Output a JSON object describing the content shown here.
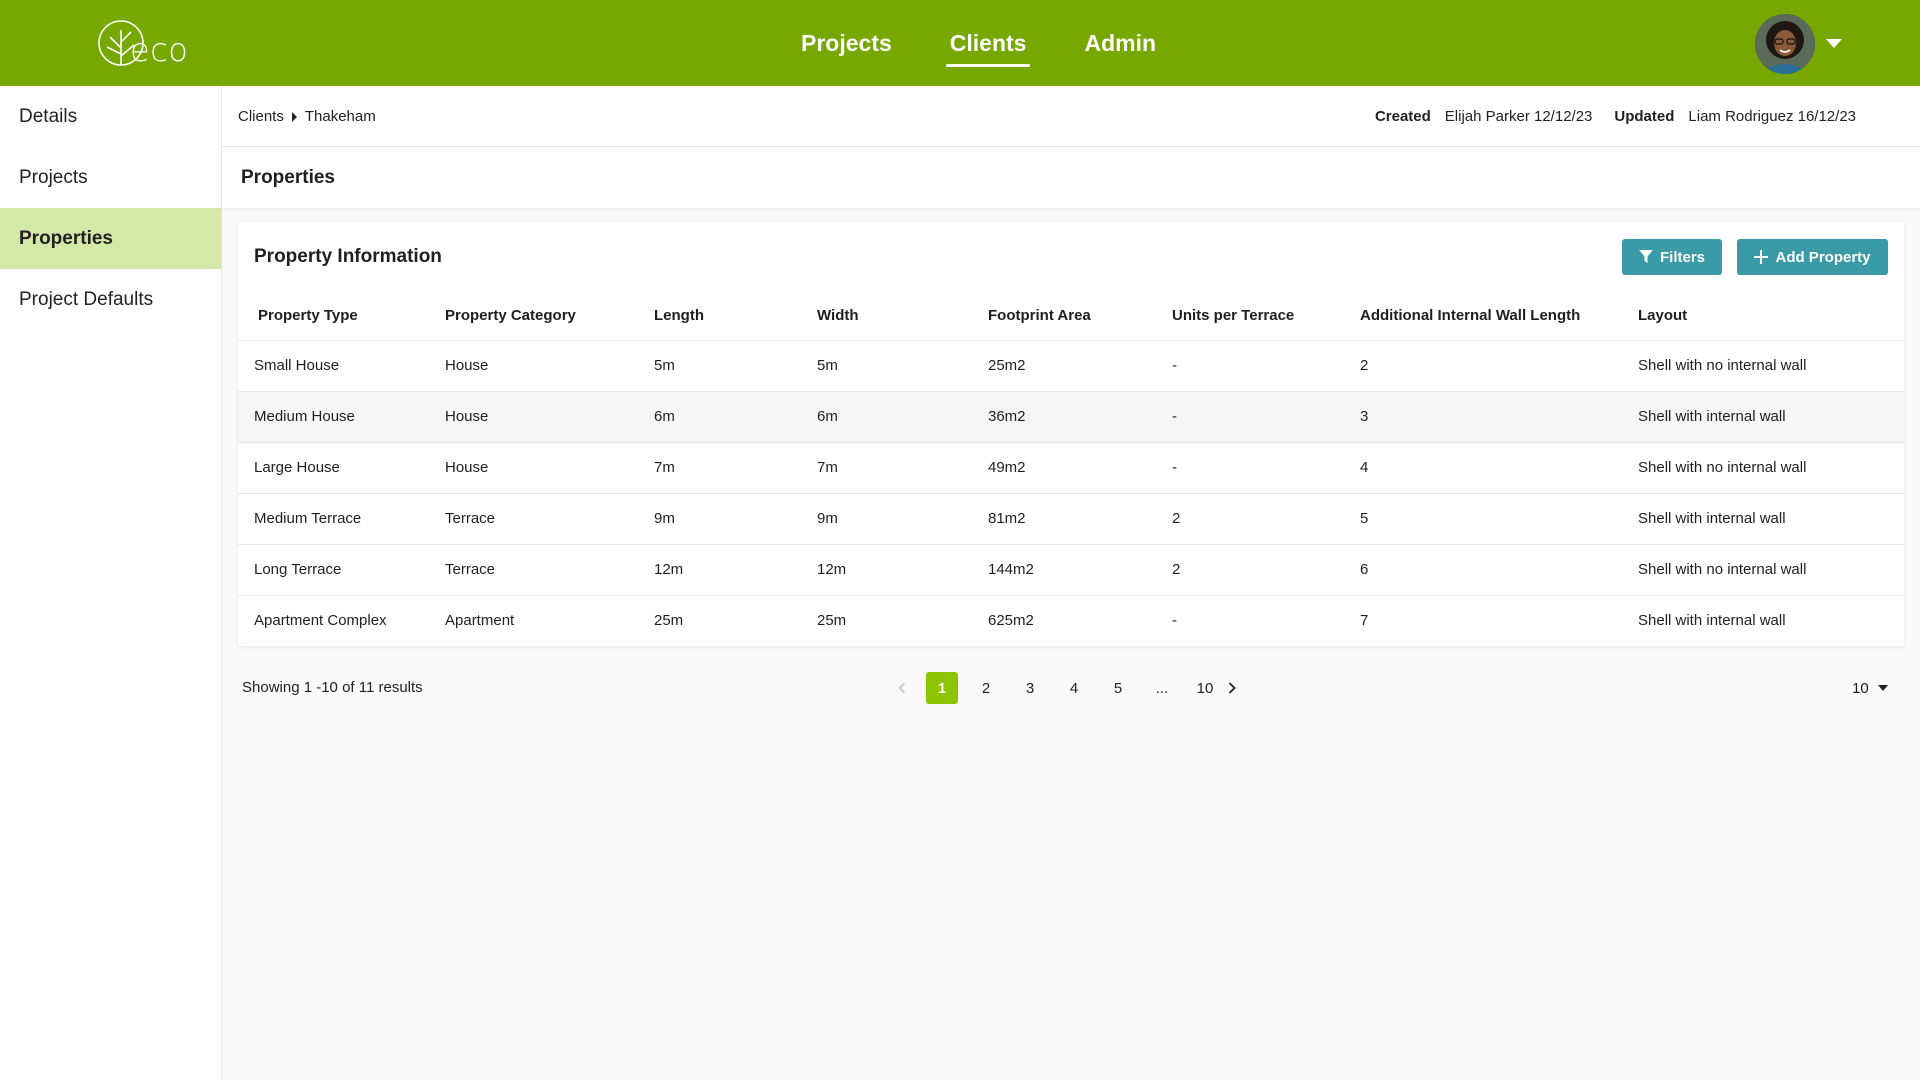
{
  "brand": {
    "logo_text": "eco",
    "primary_color": "#76a800",
    "accent_color": "#3a9aa5",
    "active_side_color": "#d5e8a8",
    "active_page_color": "#8cc400"
  },
  "nav": {
    "items": [
      "Projects",
      "Clients",
      "Admin"
    ],
    "active": "Clients"
  },
  "sidebar": {
    "items": [
      "Details",
      "Projects",
      "Properties",
      "Project Defaults"
    ],
    "active": "Properties"
  },
  "breadcrumb": {
    "root": "Clients",
    "current": "Thakeham"
  },
  "meta": {
    "created_label": "Created",
    "created_value": "Elijah Parker 12/12/23",
    "updated_label": "Updated",
    "updated_value": "Liam Rodriguez 16/12/23"
  },
  "page": {
    "title": "Properties"
  },
  "card": {
    "title": "Property Information",
    "filters_label": "Filters",
    "add_label": "Add Property"
  },
  "table": {
    "headers": [
      "Property Type",
      "Property Category",
      "Length",
      "Width",
      "Footprint Area",
      "Units per Terrace",
      "Additional Internal Wall Length",
      "Layout"
    ],
    "rows": [
      [
        "Small House",
        "House",
        "5m",
        "5m",
        "25m2",
        "-",
        "2",
        "Shell with no internal wall"
      ],
      [
        "Medium House",
        "House",
        "6m",
        "6m",
        "36m2",
        "-",
        "3",
        "Shell with internal wall"
      ],
      [
        "Large House",
        "House",
        "7m",
        "7m",
        "49m2",
        "-",
        "4",
        "Shell with no internal wall"
      ],
      [
        "Medium Terrace",
        "Terrace",
        "9m",
        "9m",
        "81m2",
        "2",
        "5",
        "Shell with internal wall"
      ],
      [
        "Long Terrace",
        "Terrace",
        "12m",
        "12m",
        "144m2",
        "2",
        "6",
        "Shell with no internal wall"
      ],
      [
        "Apartment Complex",
        "Apartment",
        "25m",
        "25m",
        "625m2",
        "-",
        "7",
        "Shell with internal wall"
      ]
    ]
  },
  "pagination": {
    "results_text": "Showing 1 -10 of 11 results",
    "pages": [
      "1",
      "2",
      "3",
      "4",
      "5",
      "...",
      "10"
    ],
    "current": "1",
    "per_page": "10"
  },
  "icons": {
    "filter": "filter-icon",
    "add": "plus-icon",
    "prev": "chevron-left-icon",
    "next": "chevron-right-icon",
    "caret": "caret-down-icon"
  }
}
